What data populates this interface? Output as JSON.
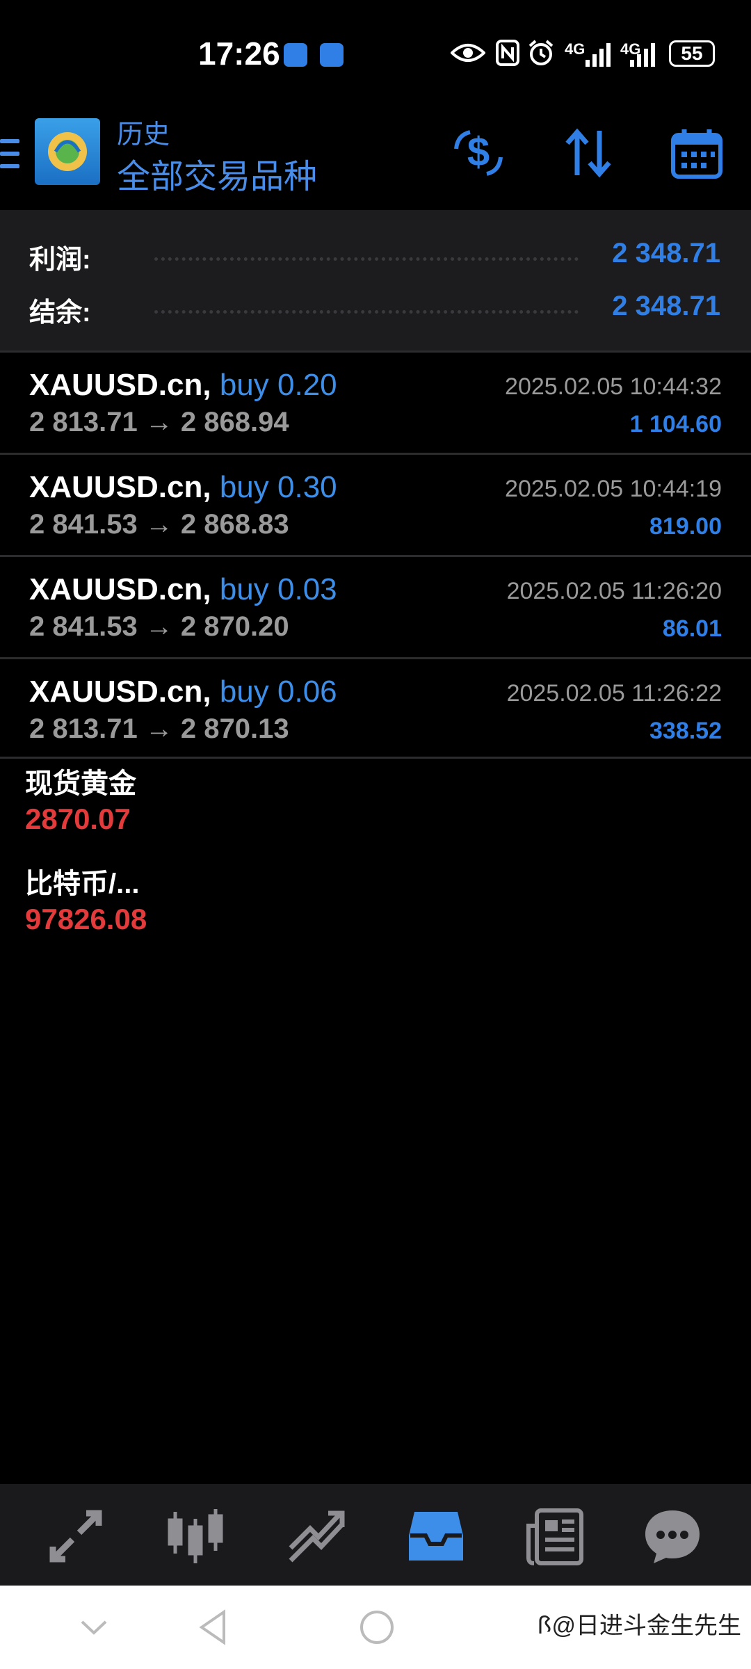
{
  "status_bar": {
    "time": "17:26",
    "network_1": "4G",
    "network_2": "4G",
    "battery": "55"
  },
  "header": {
    "subtitle": "历史",
    "title": "全部交易品种",
    "icons": [
      "menu-icon",
      "currency-exchange-icon",
      "sort-icon",
      "calendar-icon"
    ]
  },
  "summary": {
    "profit_label": "利润:",
    "profit_value": "2 348.71",
    "balance_label": "结余:",
    "balance_value": "2 348.71"
  },
  "trades": [
    {
      "symbol": "XAUUSD.cn,",
      "side": "buy 0.20",
      "prices": "2 813.71 → 2 868.94",
      "time": "2025.02.05 10:44:32",
      "profit": "1 104.60"
    },
    {
      "symbol": "XAUUSD.cn,",
      "side": "buy 0.30",
      "prices": "2 841.53 → 2 868.83",
      "time": "2025.02.05 10:44:19",
      "profit": "819.00"
    },
    {
      "symbol": "XAUUSD.cn,",
      "side": "buy 0.03",
      "prices": "2 841.53 → 2 870.20",
      "time": "2025.02.05 11:26:20",
      "profit": "86.01"
    },
    {
      "symbol": "XAUUSD.cn,",
      "side": "buy 0.06",
      "prices": "2 813.71 → 2 870.13",
      "time": "2025.02.05 11:26:22",
      "profit": "338.52"
    }
  ],
  "quotes": [
    {
      "name": "现货黄金",
      "price": "2870.07"
    },
    {
      "name": "比特币/...",
      "price": "97826.08"
    }
  ],
  "bottom_nav": {
    "items": [
      "quotes-icon",
      "chart-icon",
      "trade-icon",
      "history-icon",
      "news-icon",
      "chat-icon"
    ],
    "active": "history-icon",
    "active_color": "#3d8ee8",
    "inactive_color": "#8e8e93"
  },
  "watermark": "ꟗ@日进斗金生先生"
}
